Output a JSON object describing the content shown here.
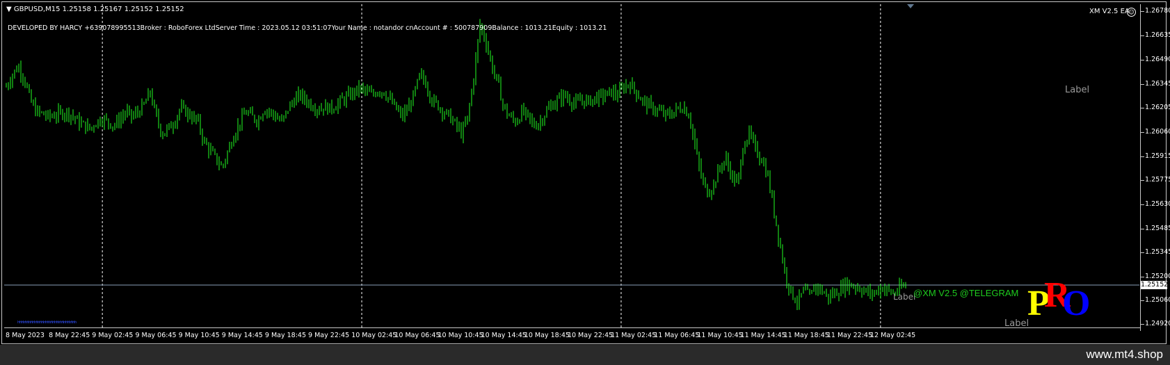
{
  "symbol_bar": {
    "symbol": "GBPUSD,M15",
    "ohlc": "1.25158 1.25167 1.25152 1.25152"
  },
  "info_line": "DEVELOPED BY HARCY +639078995513Broker  : RoboForex LtdServer Time : 2023.05.12 03:51:07Your Name    : notandor cnAccount #  : 500787909Balance : 1013.21Equity    : 1013.21",
  "ea_name": "XM V2.5 EA",
  "smiley_glyph": "☺",
  "labels": {
    "right_upper": "Label",
    "right_bottom": "Label",
    "near_watermark": "Label"
  },
  "watermark": "@XM V2.5 @TELEGRAM",
  "logo": {
    "p": "P",
    "r": "R",
    "o": "O",
    "colors": {
      "p": "#ffff00",
      "r": "#ff0000",
      "o": "#0000ff"
    }
  },
  "footer_site": "www.mt4.shop",
  "current_price": "1.25152",
  "dots_text": "ʰʰʰʰʰʰʰʰʰʰʰʰʰʰʰʰʰʰʰʰʰʰʰʰʰʰʰʰʰʰʰʰ",
  "colors": {
    "candles": "#22ff22",
    "bid_line": "#8aa0b8",
    "grid": "#c8c8c8"
  },
  "chart_data": {
    "type": "candlestick",
    "price_ticks": [
      "1.26780",
      "1.26635",
      "1.26490",
      "1.26345",
      "1.26205",
      "1.26060",
      "1.25915",
      "1.25775",
      "1.25630",
      "1.25485",
      "1.25345",
      "1.25200",
      "1.25060",
      "1.24920"
    ],
    "time_ticks": [
      "8 May 2023",
      "8 May 22:45",
      "9 May 02:45",
      "9 May 06:45",
      "9 May 10:45",
      "9 May 14:45",
      "9 May 18:45",
      "9 May 22:45",
      "10 May 02:45",
      "10 May 06:45",
      "10 May 10:45",
      "10 May 14:45",
      "10 May 18:45",
      "10 May 22:45",
      "11 May 02:45",
      "11 May 06:45",
      "11 May 10:45",
      "11 May 14:45",
      "11 May 18:45",
      "11 May 22:45",
      "12 May 02:45"
    ],
    "ylim": [
      1.249,
      1.2682
    ],
    "bid": 1.25152,
    "close_path": [
      1.2633,
      1.264,
      1.2645,
      1.2638,
      1.2625,
      1.2618,
      1.2617,
      1.2615,
      1.2616,
      1.2617,
      1.2618,
      1.2616,
      1.2612,
      1.261,
      1.2608,
      1.2612,
      1.2614,
      1.2612,
      1.261,
      1.2614,
      1.2618,
      1.2615,
      1.2618,
      1.2622,
      1.263,
      1.2615,
      1.2605,
      1.2608,
      1.2612,
      1.262,
      1.2618,
      1.2615,
      1.2612,
      1.26,
      1.2595,
      1.259,
      1.2585,
      1.2595,
      1.2605,
      1.2612,
      1.2618,
      1.2615,
      1.2613,
      1.262,
      1.2618,
      1.2615,
      1.2612,
      1.262,
      1.2625,
      1.2628,
      1.2625,
      1.2622,
      1.262,
      1.2621,
      1.262,
      1.2622,
      1.2625,
      1.2627,
      1.263,
      1.2632,
      1.263,
      1.2628,
      1.2631,
      1.263,
      1.2625,
      1.262,
      1.2615,
      1.262,
      1.2628,
      1.264,
      1.2635,
      1.2625,
      1.2622,
      1.2618,
      1.2615,
      1.261,
      1.2605,
      1.2615,
      1.264,
      1.267,
      1.266,
      1.2645,
      1.2635,
      1.262,
      1.2615,
      1.2612,
      1.2618,
      1.2615,
      1.261,
      1.2612,
      1.2618,
      1.2622,
      1.2625,
      1.2628,
      1.2625,
      1.2623,
      1.2625,
      1.2624,
      1.2626,
      1.2627,
      1.2628,
      1.263,
      1.2628,
      1.2633,
      1.2635,
      1.263,
      1.2625,
      1.2622,
      1.262,
      1.2618,
      1.2616,
      1.2617,
      1.262,
      1.2621,
      1.2615,
      1.2595,
      1.2578,
      1.257,
      1.2575,
      1.2585,
      1.259,
      1.258,
      1.2575,
      1.26,
      1.2605,
      1.2595,
      1.259,
      1.258,
      1.256,
      1.254,
      1.252,
      1.251,
      1.2505,
      1.2512,
      1.2508,
      1.2515,
      1.2512,
      1.2508,
      1.251,
      1.2512,
      1.2516,
      1.2515,
      1.2514,
      1.2512,
      1.251,
      1.2511,
      1.2514,
      1.2512,
      1.251,
      1.2513,
      1.2515
    ]
  }
}
